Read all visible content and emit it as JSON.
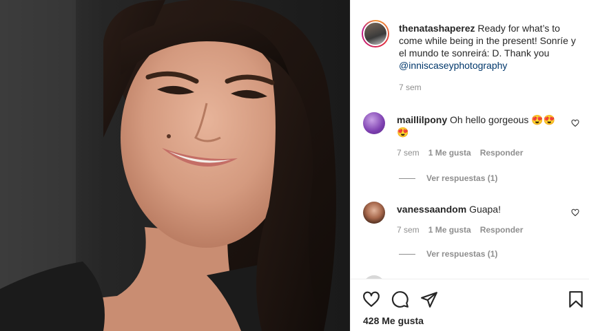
{
  "post": {
    "author": "thenatashaperez",
    "caption": "Ready for what’s to come while being in the present! Sonríe y el mundo te sonreirá: D. Thank you",
    "mention": "@inniscaseyphotography",
    "time": "7 sem",
    "likes": "428 Me gusta"
  },
  "comments": [
    {
      "user": "maillilpony",
      "text": "Oh hello gorgeous",
      "emoji": "😍😍😍",
      "time": "7 sem",
      "likes": "1 Me gusta",
      "reply": "Responder",
      "view_replies": "Ver respuestas (1)"
    },
    {
      "user": "vanessaandom",
      "text": "Guapa!",
      "time": "7 sem",
      "likes": "1 Me gusta",
      "reply": "Responder",
      "view_replies": "Ver respuestas (1)"
    }
  ],
  "icons": {
    "like": "heart-icon",
    "comment": "comment-icon",
    "share": "paper-plane-icon",
    "save": "bookmark-icon"
  }
}
